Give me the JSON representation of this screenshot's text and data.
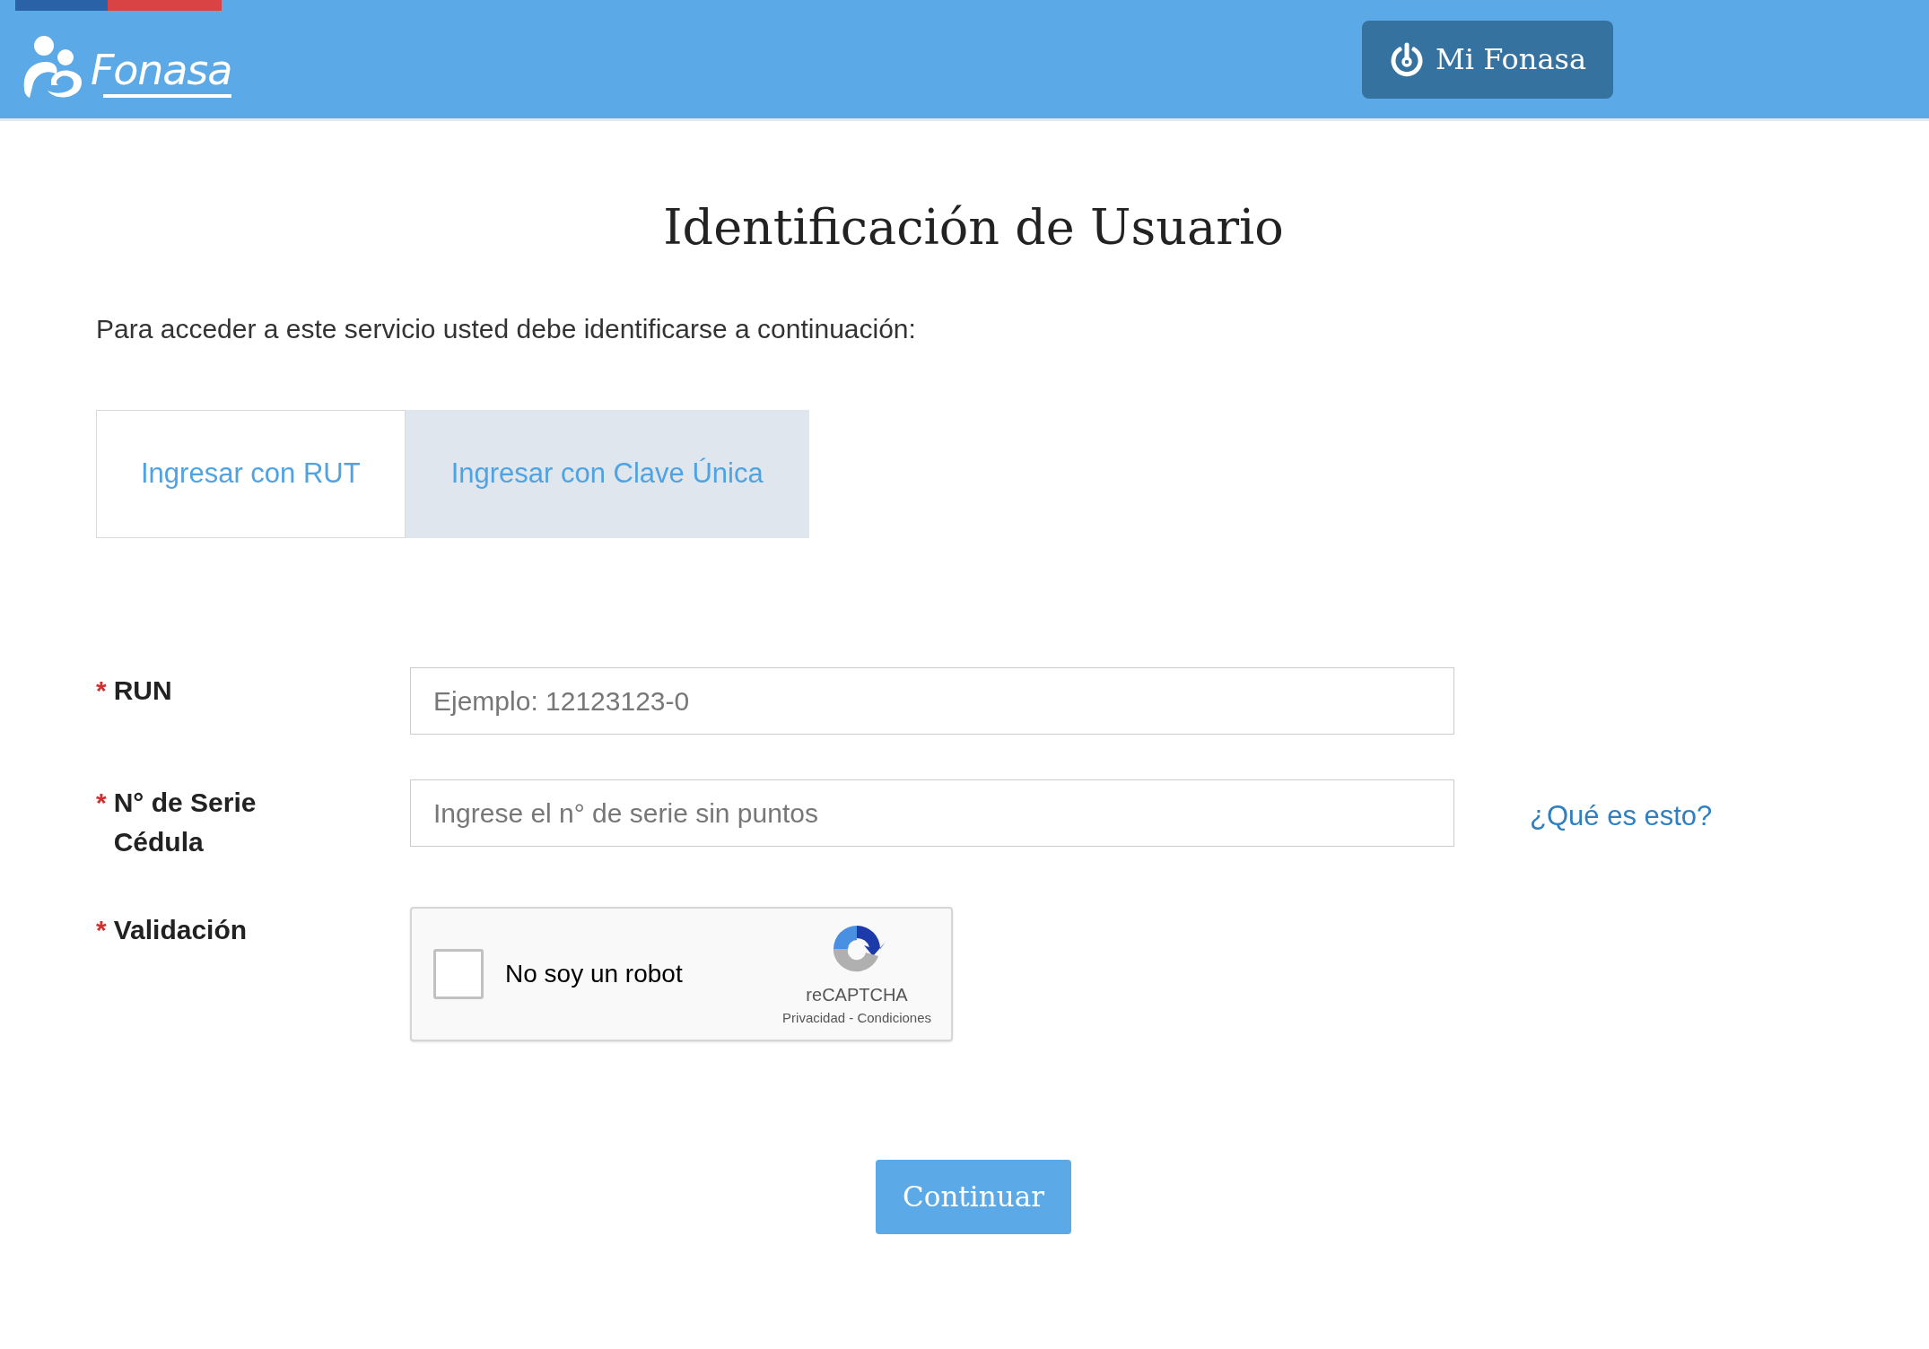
{
  "header": {
    "logo_text": "Fonasa",
    "button": "Mi Fonasa"
  },
  "title": "Identificación de Usuario",
  "intro": "Para acceder a este servicio usted debe identificarse a continuación:",
  "tabs": [
    {
      "label": "Ingresar con RUT",
      "selected": true
    },
    {
      "label": "Ingresar con Clave Única",
      "selected": false
    }
  ],
  "fields": [
    {
      "kind": "input",
      "required_mark": "*",
      "label": "RUN",
      "placeholder": "Ejemplo: 12123123-0"
    },
    {
      "kind": "input",
      "required_mark": "*",
      "label": "N° de Serie Cédula",
      "placeholder": "Ingrese el n° de serie sin puntos",
      "help_link": "¿Qué es esto?"
    },
    {
      "kind": "captcha",
      "required_mark": "*",
      "label": "Validación",
      "checkbox_label": "No soy un robot",
      "checked": false,
      "brand": "reCAPTCHA",
      "footer": "Privacidad - Condiciones"
    }
  ],
  "submit": "Continuar"
}
